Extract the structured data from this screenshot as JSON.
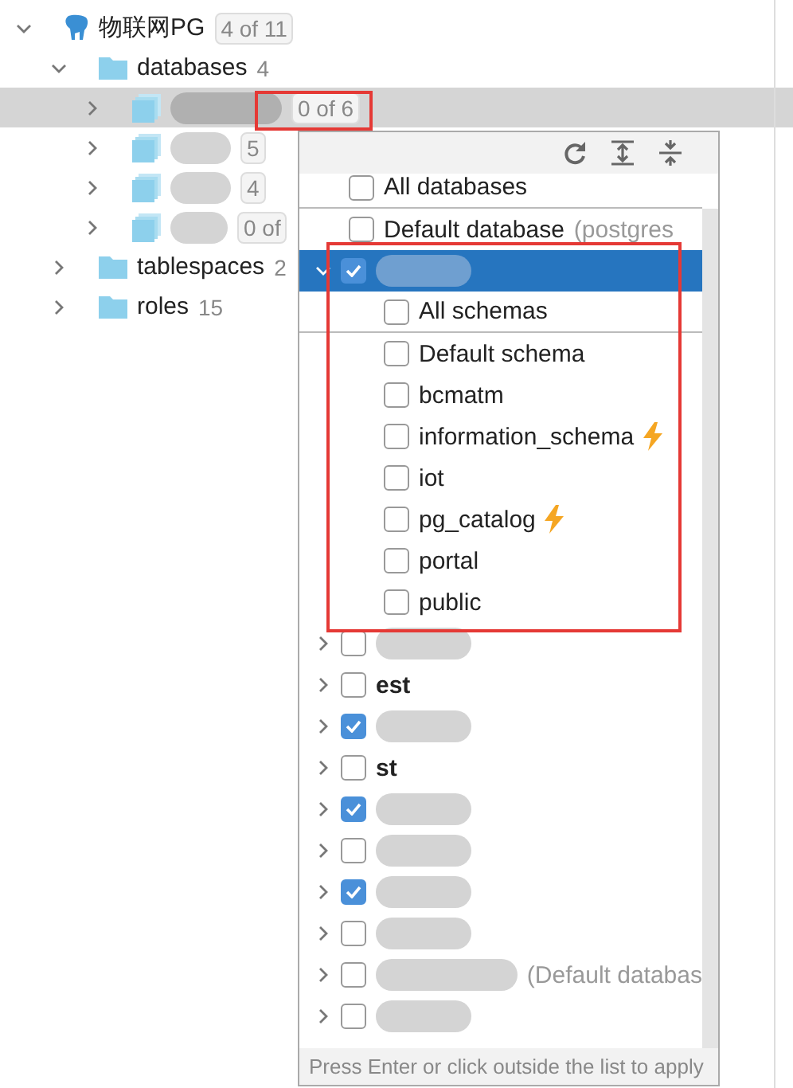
{
  "tree": {
    "label": "物联网PG",
    "badge": "4 of 11",
    "expanded": true,
    "children": [
      {
        "label": "databases",
        "count": "4",
        "expanded": true,
        "children": [
          {
            "badge": "0 of 6",
            "selected": true
          },
          {
            "badge": "5",
            "selected": false
          },
          {
            "badge": "4",
            "selected": false
          },
          {
            "badge": "0 of",
            "selected": false
          }
        ]
      },
      {
        "label": "tablespaces",
        "count": "2",
        "expanded": false
      },
      {
        "label": "roles",
        "count": "15",
        "expanded": false
      }
    ]
  },
  "popup": {
    "items": [
      {
        "kind": "all",
        "label": "All databases",
        "checked": false
      },
      {
        "kind": "database",
        "label": "Default database",
        "note": "(postgres",
        "checked": false
      },
      {
        "kind": "database",
        "checked": true,
        "selected": true,
        "expanded": true,
        "children": [
          {
            "kind": "all",
            "label": "All schemas",
            "checked": false
          },
          {
            "kind": "schema",
            "label": "Default schema",
            "checked": false
          },
          {
            "kind": "schema",
            "label": "bcmatm",
            "checked": false
          },
          {
            "kind": "schema",
            "label": "information_schema",
            "checked": false,
            "lightning": true
          },
          {
            "kind": "schema",
            "label": "iot",
            "checked": false
          },
          {
            "kind": "schema",
            "label": "pg_catalog",
            "checked": false,
            "lightning": true
          },
          {
            "kind": "schema",
            "label": "portal",
            "checked": false
          },
          {
            "kind": "schema",
            "label": "public",
            "checked": false
          }
        ]
      },
      {
        "kind": "database",
        "checked": false,
        "selected": false,
        "expanded": false
      },
      {
        "kind": "database",
        "label": "est",
        "checked": false,
        "selected": false,
        "expanded": false
      },
      {
        "kind": "database",
        "checked": true,
        "selected": false,
        "expanded": false
      },
      {
        "kind": "database",
        "label": "st",
        "checked": false,
        "selected": false,
        "expanded": false
      },
      {
        "kind": "database",
        "checked": true,
        "selected": false,
        "expanded": false
      },
      {
        "kind": "database",
        "checked": false,
        "selected": false,
        "expanded": false
      },
      {
        "kind": "database",
        "checked": true,
        "selected": false,
        "expanded": false
      },
      {
        "kind": "database",
        "checked": false,
        "selected": false,
        "expanded": false
      },
      {
        "kind": "database",
        "note": "(Default databas",
        "checked": false,
        "selected": false,
        "expanded": false
      },
      {
        "kind": "database",
        "checked": false,
        "selected": false,
        "expanded": false
      }
    ],
    "footer": "Press Enter or click outside the list to apply"
  }
}
